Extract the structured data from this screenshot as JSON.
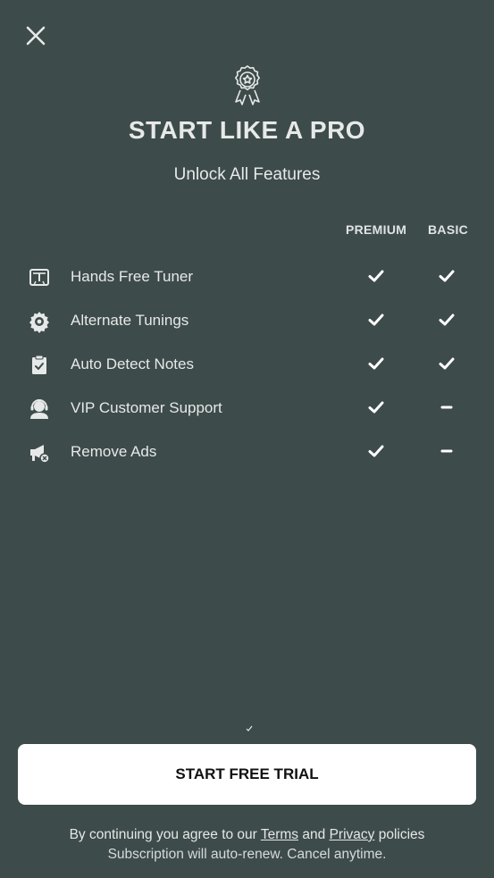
{
  "close": {
    "icon": "close-icon"
  },
  "header": {
    "badge_icon": "award-ribbon-icon",
    "title": "START LIKE A PRO",
    "subtitle": "Unlock All Features"
  },
  "columns": {
    "premium": "PREMIUM",
    "basic": "BASIC"
  },
  "features": [
    {
      "label": "Hands Free Tuner",
      "icon": "tuner-icon",
      "premium": "check",
      "basic": "check"
    },
    {
      "label": "Alternate Tunings",
      "icon": "gear-icon",
      "premium": "check",
      "basic": "check"
    },
    {
      "label": "Auto Detect Notes",
      "icon": "clipboard-check-icon",
      "premium": "check",
      "basic": "check"
    },
    {
      "label": "VIP Customer Support",
      "icon": "support-agent-icon",
      "premium": "check",
      "basic": "dash"
    },
    {
      "label": "Remove Ads",
      "icon": "megaphone-off-icon",
      "premium": "check",
      "basic": "dash"
    }
  ],
  "cta": {
    "label": "START FREE TRIAL"
  },
  "legal": {
    "prefix": "By continuing you agree to our",
    "terms": "Terms",
    "and": "and",
    "privacy": "Privacy",
    "suffix": "policies",
    "subscription": "Subscription will auto-renew. Cancel anytime."
  },
  "colors": {
    "background": "#3d4b4a",
    "button_bg": "#ffffff",
    "text": "#e6e9e8"
  }
}
